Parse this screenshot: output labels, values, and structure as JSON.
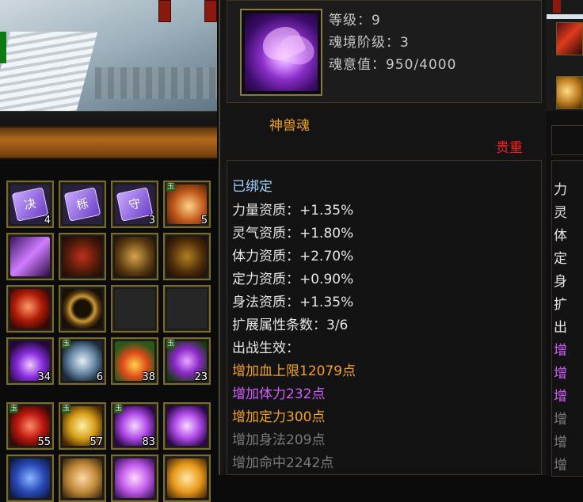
{
  "item": {
    "head": {
      "level": "等级：9",
      "soul_rank": "魂境阶级：3",
      "soul_value": "魂意值：950/4000"
    },
    "name": "神兽魂",
    "rarity": "贵重",
    "bound": "已绑定",
    "stats": [
      "力量资质：+1.35%",
      "灵气资质：+1.80%",
      "体力资质：+2.70%",
      "定力资质：+0.90%",
      "身法资质：+1.35%"
    ],
    "ext_count": "扩展属性条数：3/6",
    "effect_title": "出战生效：",
    "effects_active": [
      "增加血上限12079点",
      "增加体力232点",
      "增加定力300点"
    ],
    "effects_inactive": [
      "增加身法209点",
      "增加命中2242点"
    ]
  },
  "inventory": {
    "slots": [
      {
        "icon": "rune-jue-icon",
        "glyph": "决",
        "count": "4"
      },
      {
        "icon": "rune-li-icon",
        "glyph": "栎",
        "count": ""
      },
      {
        "icon": "rune-shou-icon",
        "glyph": "守",
        "count": "3"
      },
      {
        "icon": "phoenix-feather-icon",
        "glyph": "",
        "count": "5",
        "tag": "玉"
      },
      {
        "icon": "spear-icon",
        "glyph": "",
        "count": ""
      },
      {
        "icon": "gauntlet-icon",
        "glyph": "",
        "count": ""
      },
      {
        "icon": "helmet-icon",
        "glyph": "",
        "count": ""
      },
      {
        "icon": "armor-icon",
        "glyph": "",
        "count": ""
      },
      {
        "icon": "orb-icon",
        "glyph": "",
        "count": ""
      },
      {
        "icon": "bracelet-icon",
        "glyph": "",
        "count": ""
      },
      {
        "icon": "empty-slot-icon",
        "glyph": "",
        "count": ""
      },
      {
        "icon": "empty-slot-icon",
        "glyph": "",
        "count": ""
      },
      {
        "icon": "purple-flame-icon",
        "glyph": "",
        "count": "34"
      },
      {
        "icon": "white-wing-icon",
        "glyph": "",
        "count": "6",
        "tag": "玉"
      },
      {
        "icon": "fruit-icon",
        "glyph": "",
        "count": "38"
      },
      {
        "icon": "purple-sprite-icon",
        "glyph": "",
        "count": "23",
        "tag": "玉"
      },
      {
        "icon": "red-beast-soul-icon",
        "glyph": "",
        "count": "55",
        "tag": "玉"
      },
      {
        "icon": "gold-beast-soul-icon",
        "glyph": "",
        "count": "57",
        "tag": "玉"
      },
      {
        "icon": "violet-beast-soul-icon",
        "glyph": "",
        "count": "83",
        "tag": "玉"
      },
      {
        "icon": "violet-beast-soul-icon",
        "glyph": "",
        "count": ""
      }
    ]
  },
  "right_panel": {
    "chars": [
      "力",
      "灵",
      "体",
      "定",
      "身",
      "扩",
      "出",
      "增",
      "增",
      "增",
      "增",
      "增",
      "增"
    ]
  },
  "colors": {
    "gold": "#f4a21c",
    "purple": "#d45cff",
    "rarity_red": "#ff1e1e",
    "bound_blue": "#9fd4ff",
    "gray": "#7a7a7a"
  }
}
